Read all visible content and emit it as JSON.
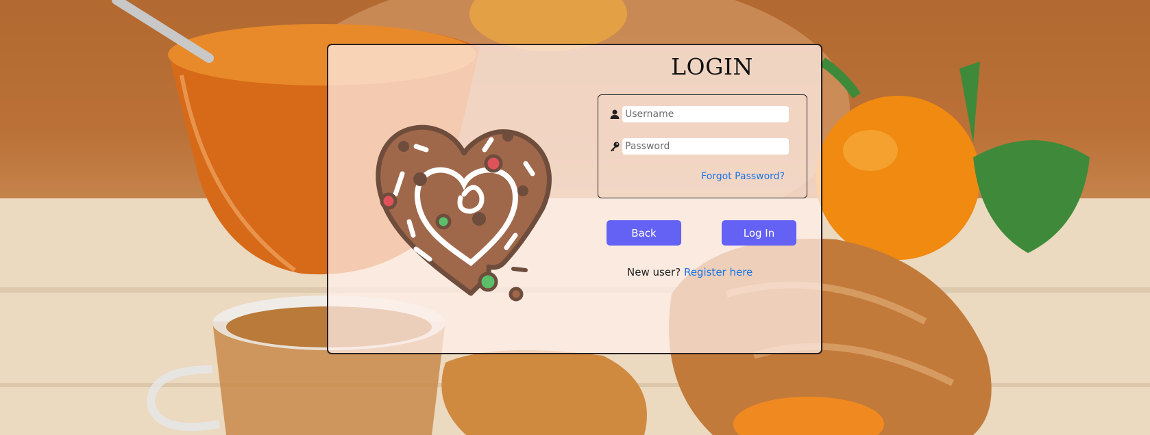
{
  "background": {
    "scene": "breakfast-photo",
    "colors": {
      "jam": "#e07a1f",
      "orange": "#f08a10",
      "leaf": "#3f8a3a",
      "table": "#ecdcc6",
      "wall": "#b86d33"
    }
  },
  "card": {
    "logo_icon": "gingerbread-heart-icon",
    "title": "LOGIN",
    "form": {
      "username": {
        "icon": "user-icon",
        "placeholder": "Username",
        "value": ""
      },
      "password": {
        "icon": "key-icon",
        "placeholder": "Password",
        "value": ""
      },
      "forgot_label": "Forgot Password?"
    },
    "buttons": {
      "back_label": "Back",
      "login_label": "Log In"
    },
    "register": {
      "prompt": "New user?",
      "link_label": "Register here"
    }
  },
  "colors": {
    "button_bg": "#6461f5",
    "link": "#1a73e8",
    "cookie": "#a0684a",
    "cookie_outline": "#6e4d3d"
  }
}
